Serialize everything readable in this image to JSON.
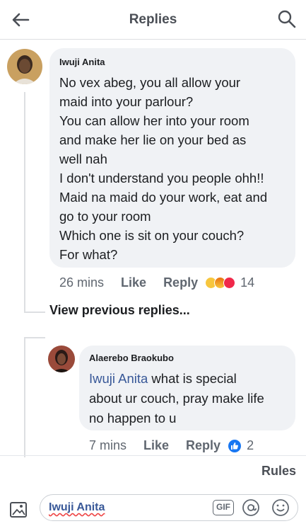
{
  "header": {
    "title": "Replies"
  },
  "comment": {
    "author": "Iwuji Anita",
    "lines": [
      "No vex abeg, you all allow your",
      "maid into your parlour?",
      "You can allow her into your room",
      "and make her lie on your bed as",
      "well nah",
      "I don't understand you people ohh!!",
      "Maid na maid do your work, eat and",
      "go to your room",
      "Which one is sit on your couch?",
      "For what?"
    ],
    "time": "26 mins",
    "like_label": "Like",
    "reply_label": "Reply",
    "reaction_count": "14"
  },
  "view_previous": "View previous replies...",
  "reply": {
    "author": "Alaerebo Braokubo",
    "mention": "Iwuji Anita",
    "line1_rest": " what is special",
    "line2": "about ur couch,  pray make life",
    "line3": "no happen to u",
    "time": "7 mins",
    "like_label": "Like",
    "reply_label": "Reply",
    "reaction_count": "2"
  },
  "rules_label": "Rules",
  "composer": {
    "text": "Iwuji Anita",
    "gif_label": "GIF"
  },
  "colors": {
    "link": "#385898",
    "meta": "#606770",
    "bubble": "#f0f2f5",
    "like_blue": "#1877f2"
  },
  "icons": [
    "back-arrow-icon",
    "search-icon",
    "photo-icon",
    "gif-icon",
    "at-icon",
    "emoji-icon"
  ]
}
